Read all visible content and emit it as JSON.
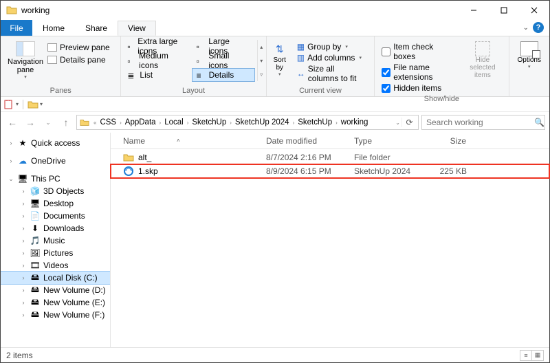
{
  "window": {
    "title": "working"
  },
  "tabs": {
    "file": "File",
    "home": "Home",
    "share": "Share",
    "view": "View"
  },
  "ribbon": {
    "panes": {
      "nav": "Navigation\npane",
      "preview": "Preview pane",
      "details": "Details pane",
      "group_label": "Panes"
    },
    "layout": {
      "extra_large": "Extra large icons",
      "large": "Large icons",
      "medium": "Medium icons",
      "small": "Small icons",
      "list": "List",
      "details": "Details",
      "group_label": "Layout"
    },
    "currentview": {
      "sort": "Sort\nby",
      "groupby": "Group by",
      "addcols": "Add columns",
      "sizeall": "Size all columns to fit",
      "group_label": "Current view"
    },
    "showhide": {
      "itemcheck": "Item check boxes",
      "fileext": "File name extensions",
      "hidden": "Hidden items",
      "hidesel": "Hide selected\nitems",
      "group_label": "Show/hide"
    },
    "options": "Options"
  },
  "breadcrumb": [
    "CSS",
    "AppData",
    "Local",
    "SketchUp",
    "SketchUp 2024",
    "SketchUp",
    "working"
  ],
  "search": {
    "placeholder": "Search working"
  },
  "columns": {
    "name": "Name",
    "date": "Date modified",
    "type": "Type",
    "size": "Size"
  },
  "files": [
    {
      "name": "alt_",
      "date": "8/7/2024 2:16 PM",
      "type": "File folder",
      "size": "",
      "kind": "folder"
    },
    {
      "name": "1.skp",
      "date": "8/9/2024 6:15 PM",
      "type": "SketchUp 2024",
      "size": "225 KB",
      "kind": "skp"
    }
  ],
  "tree": {
    "quick": "Quick access",
    "onedrive": "OneDrive",
    "thispc": "This PC",
    "items": [
      "3D Objects",
      "Desktop",
      "Documents",
      "Downloads",
      "Music",
      "Pictures",
      "Videos",
      "Local Disk (C:)",
      "New Volume (D:)",
      "New Volume (E:)",
      "New Volume (F:)"
    ]
  },
  "status": {
    "count": "2 items"
  }
}
